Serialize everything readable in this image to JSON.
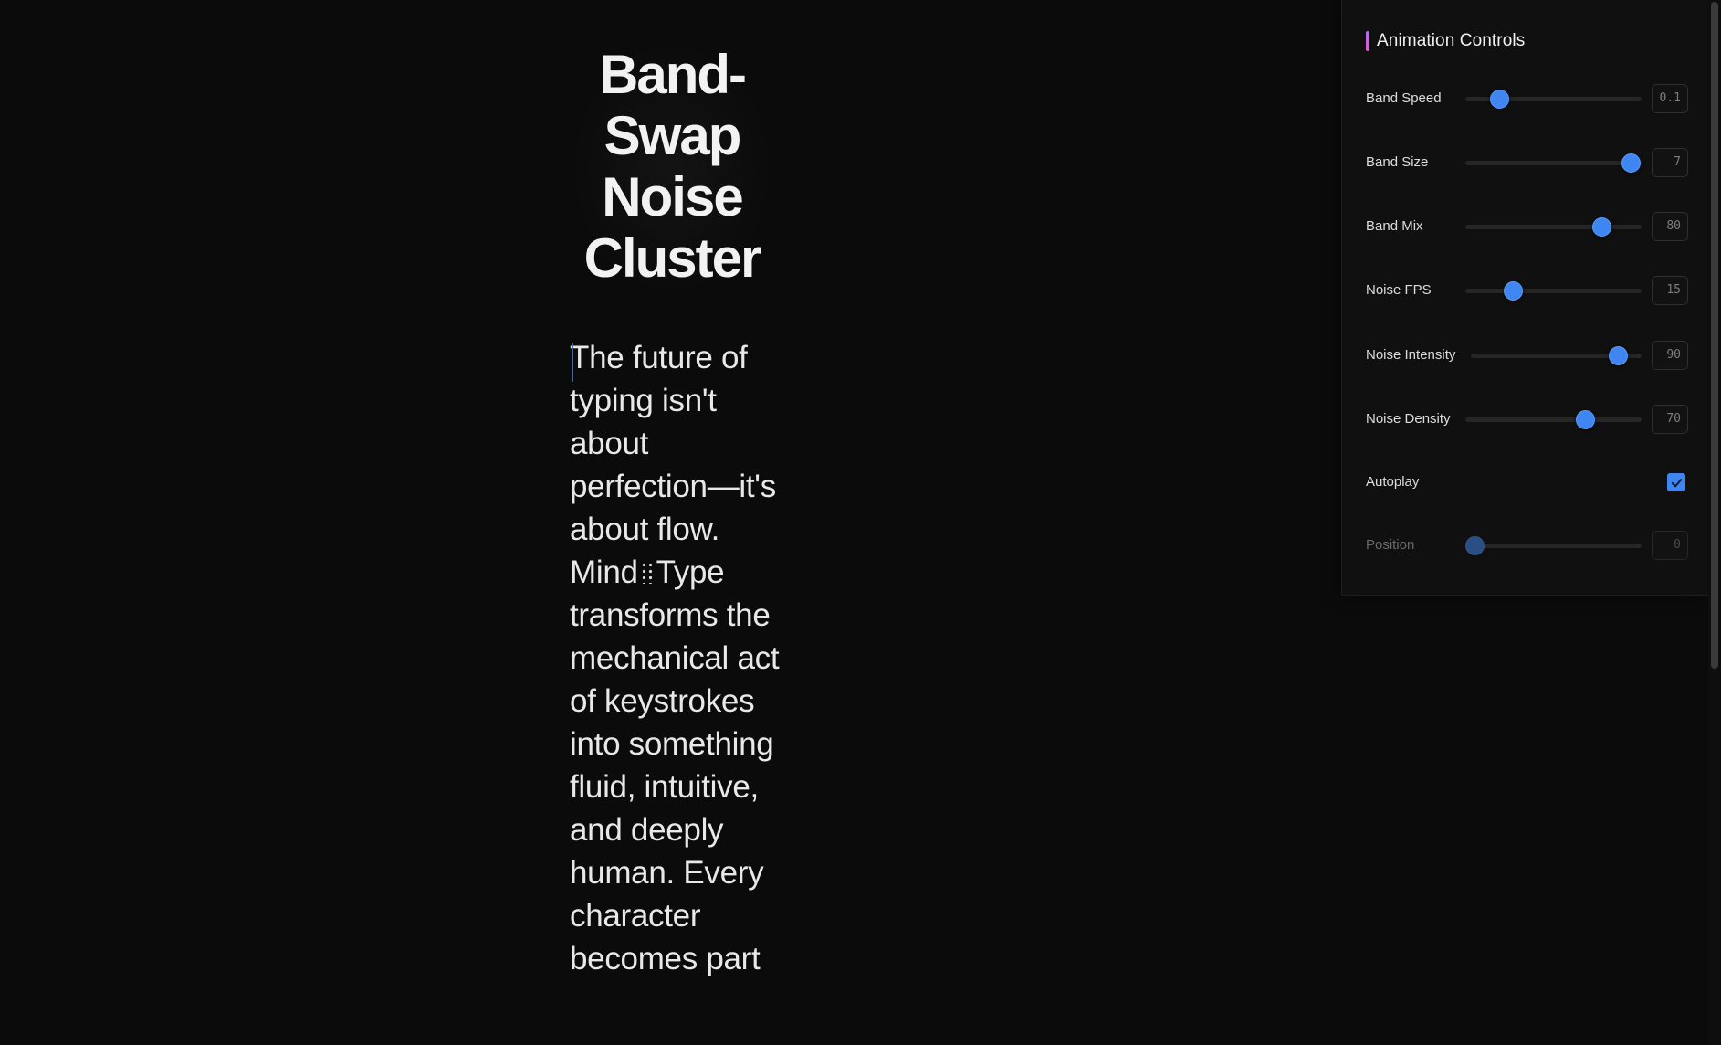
{
  "article": {
    "title_lines": [
      "Band-",
      "Swap",
      "Noise",
      "Cluster"
    ],
    "body_before_grip": "The future of typing isn't about perfection—it's about flow. Mind",
    "body_after_grip": "Type transforms the mechanical act of keystrokes into something fluid, intuitive, and deeply human. Every character becomes part"
  },
  "panel": {
    "title": "Animation Controls",
    "controls": [
      {
        "label": "Band Speed",
        "value": "0.1",
        "fraction": 0.19
      },
      {
        "label": "Band Size",
        "value": "7",
        "fraction": 0.94
      },
      {
        "label": "Band Mix",
        "value": "80",
        "fraction": 0.77
      },
      {
        "label": "Noise FPS",
        "value": "15",
        "fraction": 0.27
      },
      {
        "label": "Noise Intensity",
        "value": "90",
        "fraction": 0.86
      },
      {
        "label": "Noise Density",
        "value": "70",
        "fraction": 0.68
      }
    ],
    "autoplay": {
      "label": "Autoplay",
      "checked": true
    },
    "position": {
      "label": "Position",
      "value": "0",
      "fraction": 0.05,
      "disabled": true
    }
  },
  "colors": {
    "accent_blue": "#3f86f3",
    "accent_gradient_top": "#b46cf5",
    "accent_gradient_bottom": "#e25acb"
  },
  "icons": {
    "checkbox": "check-icon",
    "inline_separator": "grip-dots-icon"
  }
}
